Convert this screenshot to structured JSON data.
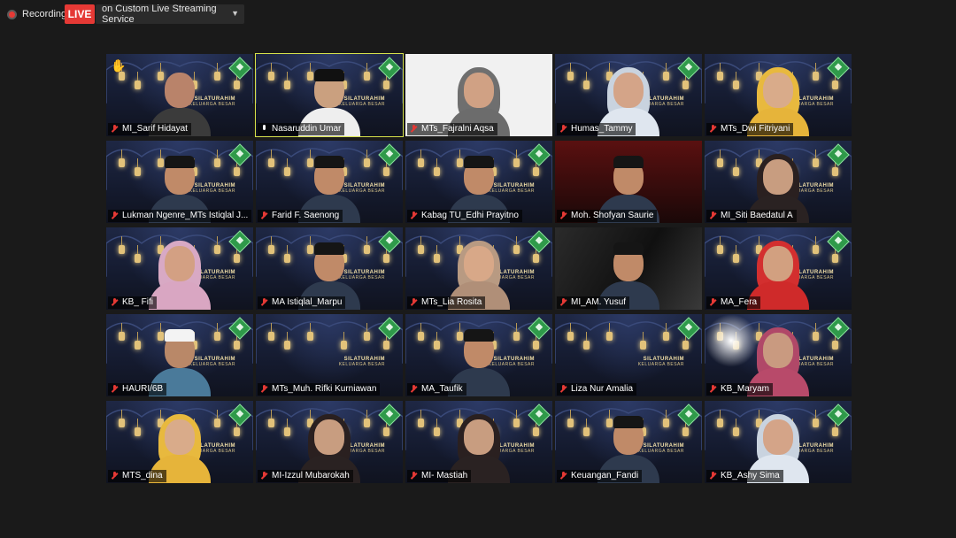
{
  "topbar": {
    "recording_label": "Recording",
    "live_badge": "LIVE",
    "stream_target": "on Custom Live Streaming Service"
  },
  "banner": {
    "line1": "SILATURAHIM",
    "line2": "KELUARGA BESAR"
  },
  "participants": [
    {
      "name": "MI_Sarif Hidayat",
      "muted": true,
      "hand_raised": true,
      "bg": "mosque",
      "look": "man"
    },
    {
      "name": "Nasaruddin Umar",
      "muted": false,
      "active": true,
      "bg": "mosque",
      "look": "man-cap-white"
    },
    {
      "name": "MTs_Fajralni Aqsa",
      "muted": true,
      "bg": "plain",
      "look": "hijab-grey"
    },
    {
      "name": "Humas_Tammy",
      "muted": true,
      "bg": "mosque",
      "look": "hijab-pattern"
    },
    {
      "name": "MTs_Dwi Fitriyani",
      "muted": true,
      "bg": "mosque",
      "look": "hijab-yellow"
    },
    {
      "name": "Lukman Ngenre_MTs Istiqlal J...",
      "muted": true,
      "bg": "mosque",
      "look": "man-cap"
    },
    {
      "name": "Farid F. Saenong",
      "muted": true,
      "bg": "mosque",
      "look": "man-cap"
    },
    {
      "name": "Kabag TU_Edhi Prayitno",
      "muted": true,
      "bg": "mosque",
      "look": "man-cap"
    },
    {
      "name": "Moh. Shofyan Saurie",
      "muted": true,
      "bg": "red",
      "look": "man-cap"
    },
    {
      "name": "MI_Siti Baedatul A",
      "muted": true,
      "bg": "mosque",
      "look": "hijab-dark"
    },
    {
      "name": "KB_ Fifi",
      "muted": true,
      "bg": "mosque",
      "look": "hijab-pink"
    },
    {
      "name": "MA Istiqlal_Marpu",
      "muted": true,
      "bg": "mosque",
      "look": "man-cap"
    },
    {
      "name": "MTs_Lia Rosita",
      "muted": true,
      "bg": "mosque",
      "look": "hijab-tan"
    },
    {
      "name": "MI_AM. Yusuf",
      "muted": true,
      "bg": "collage",
      "look": "man-cap"
    },
    {
      "name": "MA_Fera",
      "muted": true,
      "bg": "mosque",
      "look": "hijab-red"
    },
    {
      "name": "HAURI/6B",
      "muted": true,
      "bg": "mosque",
      "look": "man-white-cap"
    },
    {
      "name": "MTs_Muh. Rifki Kurniawan",
      "muted": true,
      "bg": "mosque",
      "look": "none"
    },
    {
      "name": "MA_Taufik",
      "muted": true,
      "bg": "mosque",
      "look": "man-cap"
    },
    {
      "name": "Liza Nur Amalia",
      "muted": true,
      "bg": "mosque",
      "look": "none"
    },
    {
      "name": "KB_Maryam",
      "muted": true,
      "bg": "mosque-glow",
      "look": "hijab-rose"
    },
    {
      "name": "MTS_dina",
      "muted": true,
      "bg": "mosque",
      "look": "hijab-yellow"
    },
    {
      "name": "MI-Izzul Mubarokah",
      "muted": true,
      "bg": "mosque",
      "look": "hijab-dark"
    },
    {
      "name": "MI- Mastiah",
      "muted": true,
      "bg": "mosque",
      "look": "hijab-dark"
    },
    {
      "name": "Keuangan_Fandi",
      "muted": true,
      "bg": "mosque",
      "look": "man-cap"
    },
    {
      "name": "KB_Ashy Sima",
      "muted": true,
      "bg": "mosque",
      "look": "hijab-pattern"
    }
  ],
  "colors": {
    "accent_live": "#e53935",
    "active_border": "#d6e14a",
    "logo_green": "#2f9a4a"
  }
}
